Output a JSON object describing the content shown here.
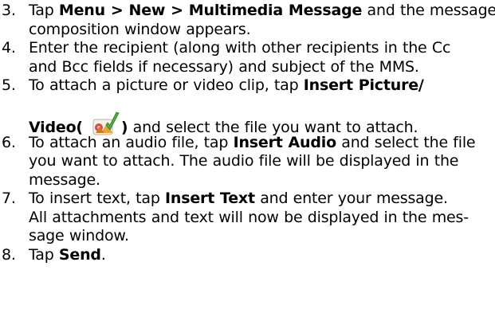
{
  "steps": [
    {
      "number": "3.",
      "lines": [
        [
          {
            "text": "Tap ",
            "bold": false
          },
          {
            "text": "Menu > New > Multimedia Message",
            "bold": true
          },
          {
            "text": " and the message",
            "bold": false
          }
        ],
        [
          {
            "text": "composition window appears.",
            "bold": false
          }
        ]
      ]
    },
    {
      "number": "4.",
      "lines": [
        [
          {
            "text": "Enter the recipient (along with other recipients in the Cc",
            "bold": false
          }
        ],
        [
          {
            "text": "and Bcc fields if necessary) and subject of the MMS.",
            "bold": false
          }
        ]
      ]
    },
    {
      "number": "5.",
      "lines": [
        [
          {
            "text": "To attach a picture or video clip, tap ",
            "bold": false
          },
          {
            "text": "Insert Picture/",
            "bold": true
          }
        ],
        [
          {
            "text": "Video( ",
            "bold": true
          },
          {
            "icon": "insert-picture-video-icon"
          },
          {
            "text": ")",
            "bold": true
          },
          {
            "text": " and select the file you want to attach.",
            "bold": false
          }
        ]
      ]
    },
    {
      "number": "6.",
      "lines": [
        [
          {
            "text": "To attach an audio file, tap ",
            "bold": false
          },
          {
            "text": "Insert Audio",
            "bold": true
          },
          {
            "text": " and select the file",
            "bold": false
          }
        ],
        [
          {
            "text": "you want to attach. The audio file will be displayed in the",
            "bold": false
          }
        ],
        [
          {
            "text": "message.",
            "bold": false
          }
        ]
      ]
    },
    {
      "number": "7.",
      "lines": [
        [
          {
            "text": "To insert text, tap ",
            "bold": false
          },
          {
            "text": "Insert Text",
            "bold": true
          },
          {
            "text": " and enter your message.",
            "bold": false
          }
        ],
        [
          {
            "text": "All attachments and text will now be displayed in the mes-",
            "bold": false
          }
        ],
        [
          {
            "text": "sage window.",
            "bold": false
          }
        ]
      ]
    },
    {
      "number": "8.",
      "lines": [
        [
          {
            "text": "Tap ",
            "bold": false
          },
          {
            "text": "Send",
            "bold": true
          },
          {
            "text": ".",
            "bold": false
          }
        ]
      ]
    }
  ]
}
